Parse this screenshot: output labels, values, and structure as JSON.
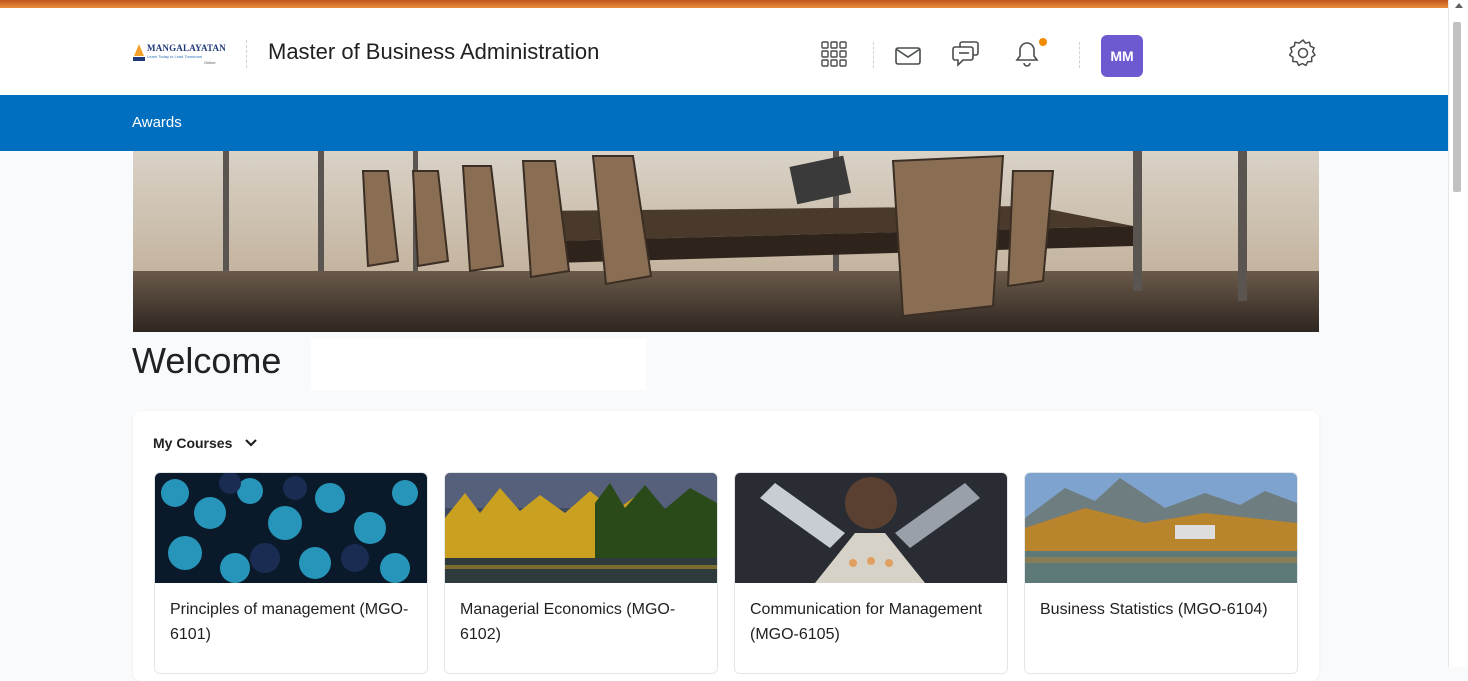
{
  "header": {
    "logo_text": "MANGALAYATAN",
    "logo_tagline": "Learn Today to Lead Tomorrow",
    "logo_online": "Online",
    "site_title": "Master of Business Administration",
    "icons": [
      "apps-grid-icon",
      "mail-icon",
      "chat-icon",
      "bell-icon",
      "settings-gear-icon"
    ],
    "avatar_initials": "MM",
    "notification_color": "#f18a00",
    "avatar_color": "#6e5ad0"
  },
  "navbar": {
    "items": [
      "Awards"
    ],
    "color": "#006fbf"
  },
  "main": {
    "welcome_label": "Welcome",
    "my_courses_label": "My Courses",
    "courses": [
      {
        "title": "Principles of management (MGO-6101)",
        "image": "blue-glass-spheres"
      },
      {
        "title": "Managerial Economics (MGO-6102)",
        "image": "forest-lake-sunset"
      },
      {
        "title": "Communication for Management (MGO-6105)",
        "image": "mechanical-gears-abstract"
      },
      {
        "title": "Business Statistics (MGO-6104)",
        "image": "mountain-lake-landscape"
      }
    ]
  }
}
